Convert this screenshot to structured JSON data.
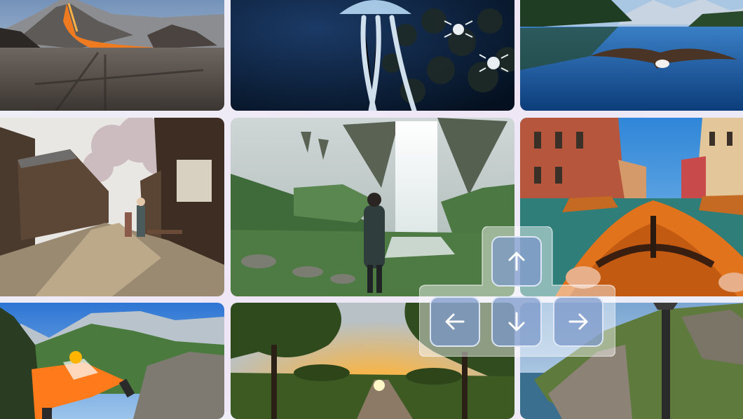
{
  "gallery": {
    "tiles": [
      {
        "name": "volcano-eruption-scene"
      },
      {
        "name": "jellyfish-and-crabs-underwater-scene"
      },
      {
        "name": "eagle-flying-over-lake-scene"
      },
      {
        "name": "traditional-japanese-street-scene"
      },
      {
        "name": "floating-islands-waterfall-scene"
      },
      {
        "name": "venice-canal-boat-driving-scene"
      },
      {
        "name": "wingsuit-flight-mountains-scene"
      },
      {
        "name": "tree-lined-road-sunset-scene"
      },
      {
        "name": "coastal-cliffs-flyover-scene"
      }
    ]
  },
  "controls": {
    "keys": [
      {
        "id": "up",
        "icon": "arrow-up-icon"
      },
      {
        "id": "left",
        "icon": "arrow-left-icon"
      },
      {
        "id": "down",
        "icon": "arrow-down-icon"
      },
      {
        "id": "right",
        "icon": "arrow-right-icon"
      }
    ]
  },
  "colors": {
    "key_fill": "#7896c8",
    "key_border": "#ebf2ff",
    "keypad_panel": "#ffffff",
    "page_background": "#eef0f8"
  }
}
